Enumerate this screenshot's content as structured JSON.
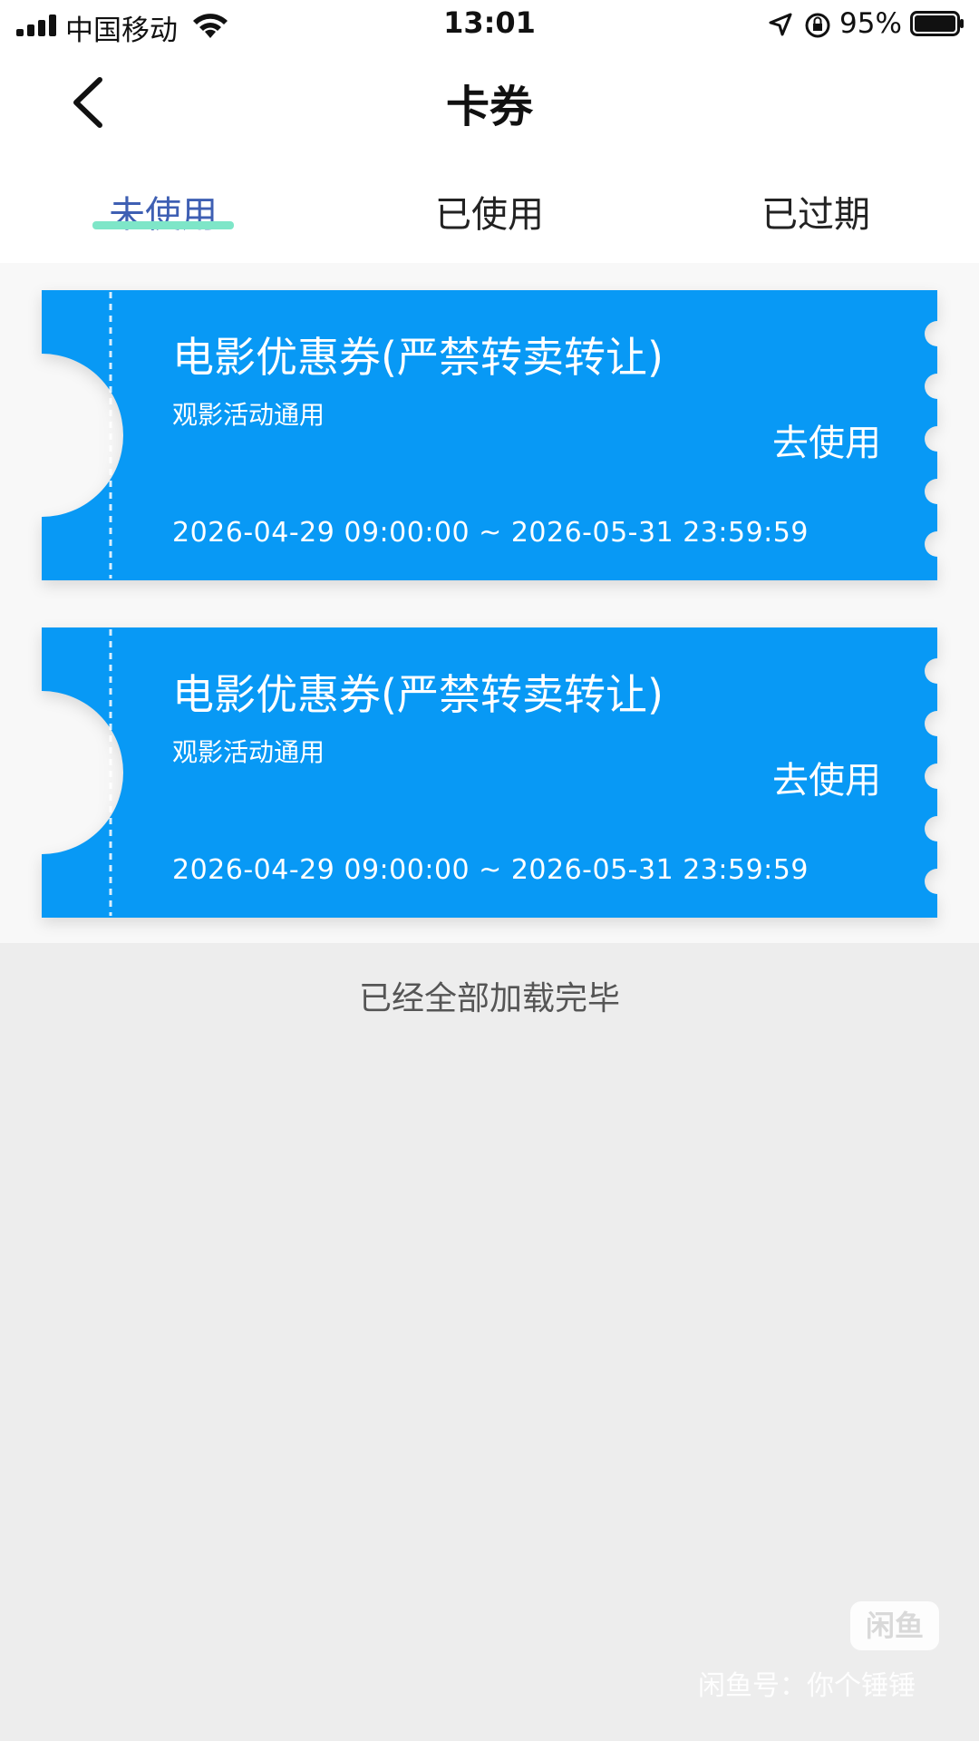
{
  "status_bar": {
    "carrier": "中国移动",
    "time": "13:01",
    "battery_percent": "95%",
    "signal_bars": 4
  },
  "nav": {
    "title": "卡券",
    "back_icon": "chevron-left-icon"
  },
  "tabs": [
    {
      "label": "未使用",
      "active": true
    },
    {
      "label": "已使用",
      "active": false
    },
    {
      "label": "已过期",
      "active": false
    }
  ],
  "colors": {
    "coupon_bg": "#0899f5",
    "active_tab_text": "#3e5fb3",
    "tab_indicator": "#7ee6c8",
    "page_bg": "#ededed"
  },
  "coupons": [
    {
      "title": "电影优惠券(严禁转卖转让)",
      "subtitle": "观影活动通用",
      "action": "去使用",
      "validity": "2026-04-29 09:00:00 ~ 2026-05-31 23:59:59"
    },
    {
      "title": "电影优惠券(严禁转卖转让)",
      "subtitle": "观影活动通用",
      "action": "去使用",
      "validity": "2026-04-29 09:00:00 ~ 2026-05-31 23:59:59"
    }
  ],
  "list_footer": "已经全部加载完毕",
  "watermark": {
    "logo_text": "闲鱼",
    "text": "闲鱼号：你个锤锤"
  }
}
